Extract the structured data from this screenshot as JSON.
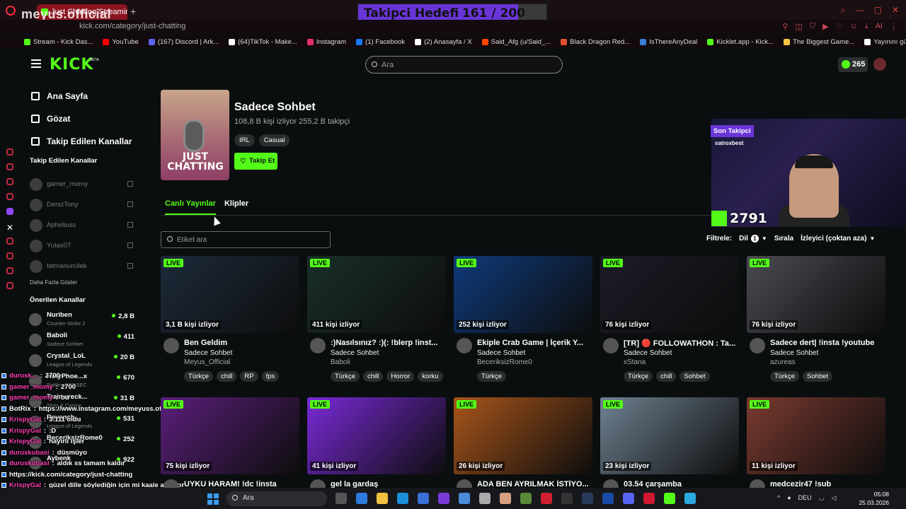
{
  "browser": {
    "tab_title": "Just Chatting Streaming",
    "url": "kick.com/category/just-chatting",
    "bookmarks": [
      {
        "label": "Stream - Kick Das...",
        "color": "#53fc18"
      },
      {
        "label": "YouTube",
        "color": "#ff0000"
      },
      {
        "label": "(167) Discord | Ark...",
        "color": "#5865f2"
      },
      {
        "label": "(64)TikTok - Make...",
        "color": "#ffffff"
      },
      {
        "label": "Instagram",
        "color": "#e1306c"
      },
      {
        "label": "(1) Facebook",
        "color": "#1877f2"
      },
      {
        "label": "(2) Anasayfa / X",
        "color": "#ffffff"
      },
      {
        "label": "Said_Afg (u/Said_...",
        "color": "#ff4500"
      },
      {
        "label": "Black Dragon Red...",
        "color": "#e0522d"
      },
      {
        "label": "IsThereAnyDeal",
        "color": "#3b7dd8"
      },
      {
        "label": "Kicklet.app - Kick...",
        "color": "#53fc18"
      },
      {
        "label": "The Biggest Game...",
        "color": "#f5c542"
      },
      {
        "label": "Yayınını güçlendir...",
        "color": "#ffffff"
      }
    ]
  },
  "overlay": {
    "tiktok_handle": "meyus.official",
    "goal_label": "Takipci Hedefi",
    "goal_value": "161 / 200",
    "last_follower_label": "Son Takipci",
    "last_follower_name": "satroxbest",
    "kick_count": "2791"
  },
  "header": {
    "logo": "KICK",
    "beta": "BETA",
    "search_placeholder": "Ara",
    "coins": "265"
  },
  "sidebar": {
    "nav": [
      {
        "label": "Ana Sayfa",
        "icon": "home-icon"
      },
      {
        "label": "Gözat",
        "icon": "browse-icon"
      },
      {
        "label": "Takip Edilen Kanallar",
        "icon": "heart-icon"
      }
    ],
    "followed_title": "Takip Edilen Kanallar",
    "followed": [
      "gamer_momy",
      "DenizTony",
      "Apheliuss",
      "Yutax07",
      "fatmanurcilek"
    ],
    "show_more": "Daha Fazla Göster",
    "recommended_title": "Önerilen Kanallar",
    "recommended": [
      {
        "name": "Nuriben",
        "category": "Counter-Strike 2",
        "viewers": "2,8 B"
      },
      {
        "name": "Baboli",
        "category": "Sadece Sohbet",
        "viewers": "411"
      },
      {
        "name": "Crystal_LoL",
        "category": "League of Legends",
        "viewers": "20 B"
      },
      {
        "name": "HolyPhoe...x",
        "category": "Battle...REDSEC",
        "viewers": "670"
      },
      {
        "name": "Trainwreck...",
        "category": "Slots & Casino",
        "viewers": "31 B"
      },
      {
        "name": "Revanch...",
        "category": "League of Legends",
        "viewers": "531"
      },
      {
        "name": "BeceriksizRome0",
        "category": "",
        "viewers": "252"
      },
      {
        "name": "Aybenk",
        "category": "",
        "viewers": "922"
      }
    ]
  },
  "chat": [
    {
      "user": "durusk...",
      "msg": "2700"
    },
    {
      "user": "gamer_momy",
      "msg": "2700"
    },
    {
      "user": "gamer_momy",
      "msg": "bu"
    },
    {
      "user": "BotRix",
      "msg": "https://www.instagram.com/meyuss.official/"
    },
    {
      "user": "KrispyGal",
      "msg": "3.111 oldu"
    },
    {
      "user": "KrispyGal",
      "msg": ":D"
    },
    {
      "user": "KrispyGal",
      "msg": "hayırlı işler"
    },
    {
      "user": "duruskubasi",
      "msg": "düsmüyo"
    },
    {
      "user": "duruskubasi",
      "msg": "aldık ss tamam kaldır"
    },
    {
      "user": "",
      "msg": "https://kick.com/category/just-chatting"
    },
    {
      "user": "KrispyGal",
      "msg": "güzel dille söylediğin için mi kaale almıyor"
    },
    {
      "user": "gamer_momy",
      "msg": "sureli iste"
    }
  ],
  "category": {
    "image_label": "JUST CHATTING",
    "title": "Sadece Sohbet",
    "meta": "108,8 B kişi izliyor  255,2 B takipçi",
    "tags": [
      "IRL",
      "Casual"
    ],
    "follow_button": "Takip Et"
  },
  "tabs": [
    "Canlı Yayınlar",
    "Klipler"
  ],
  "tag_search_placeholder": "Etiket ara",
  "filters": {
    "label": "Filtrele:",
    "language": "Dil",
    "language_count": "1",
    "sort_label": "Sırala",
    "sort_value": "İzleyici (çoktan aza)"
  },
  "live_label": "LIVE",
  "streams": [
    {
      "viewers": "3,1 B kişi izliyor",
      "title": "Ben Geldim",
      "category": "Sadece Sohbet",
      "user": "Meyus_Official",
      "tags": [
        "Türkçe",
        "chill",
        "RP",
        "fps"
      ],
      "color": "#1d2a3a"
    },
    {
      "viewers": "411 kişi izliyor",
      "title": ":)Nasılsınız? :)(: !blerp !inst...",
      "category": "Sadece Sohbet",
      "user": "Baboli",
      "tags": [
        "Türkçe",
        "chill",
        "Horror",
        "korku"
      ],
      "color": "#1a2f28"
    },
    {
      "viewers": "252 kişi izliyor",
      "title": "Ekiple Crab Game | İçerik Y...",
      "category": "Sadece Sohbet",
      "user": "BeceriksizRome0",
      "tags": [
        "Türkçe"
      ],
      "color": "#0f3a7a"
    },
    {
      "viewers": "76 kişi izliyor",
      "title": "[TR] 🔴 FOLLOWATHON : Ta...",
      "category": "Sadece Sohbet",
      "user": "xStana",
      "tags": [
        "Türkçe",
        "chill",
        "Sohbet"
      ],
      "color": "#1b1c26"
    },
    {
      "viewers": "76 kişi izliyor",
      "title": "Sadece dert| !insta !youtube",
      "category": "Sadece Sohbet",
      "user": "azureas",
      "tags": [
        "Türkçe",
        "Sohbet"
      ],
      "color": "#4a4a52"
    },
    {
      "viewers": "75 kişi izliyor",
      "title": "UYKU HARAM! !dc !insta",
      "category": "",
      "user": "",
      "tags": [],
      "color": "#5a1f7a"
    },
    {
      "viewers": "41 kişi izliyor",
      "title": "gel la gardaş",
      "category": "",
      "user": "",
      "tags": [],
      "color": "#7a2ad8"
    },
    {
      "viewers": "26 kişi izliyor",
      "title": "ADA BEN AYRILMAK İSTİYO...",
      "category": "",
      "user": "",
      "tags": [],
      "color": "#a8551a"
    },
    {
      "viewers": "23 kişi izliyor",
      "title": "03.54 çarşamba",
      "category": "",
      "user": "",
      "tags": [],
      "color": "#6f8191"
    },
    {
      "viewers": "11 kişi izliyor",
      "title": "medcezir47 !sub",
      "category": "",
      "user": "",
      "tags": [],
      "color": "#7a3a30"
    }
  ],
  "taskbar": {
    "search": "Ara",
    "lang": "DEU",
    "time": "05:08",
    "date": "25.03.2026"
  }
}
